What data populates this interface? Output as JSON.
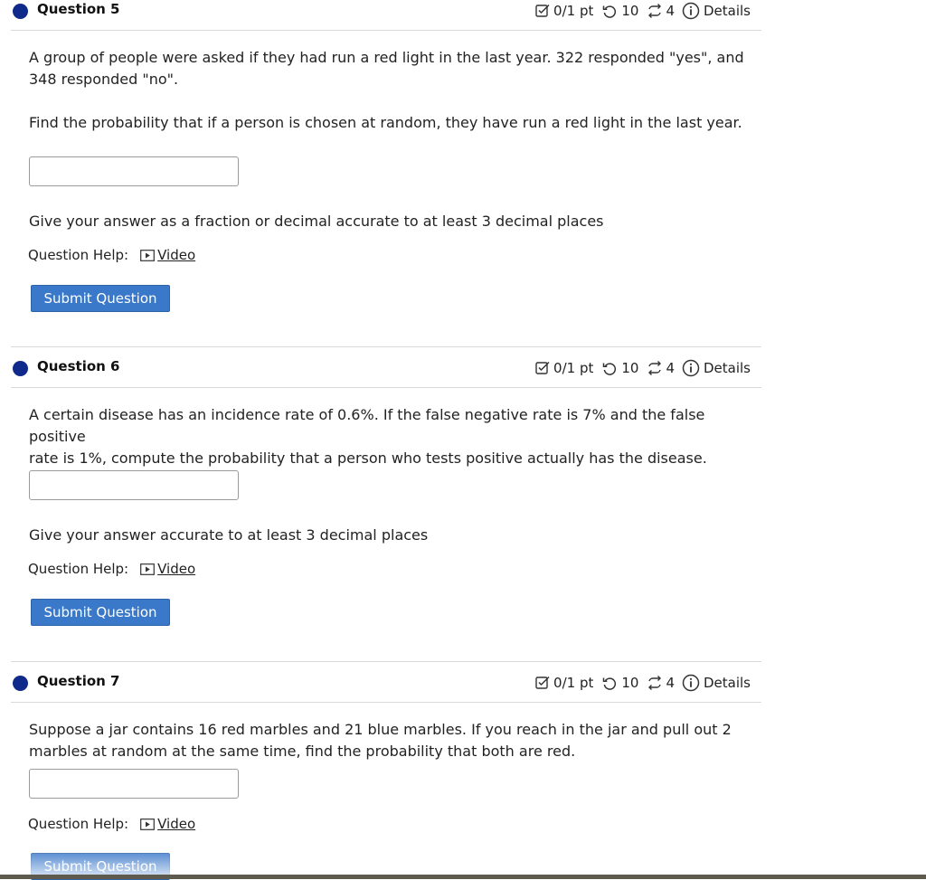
{
  "questions": [
    {
      "title": "Question 5",
      "score": "0/1 pt",
      "retries": "10",
      "attempts": "4",
      "details_label": "Details",
      "text_lines": [
        "A group of people were asked if they had run a red light in the last year. 322 responded \"yes\", and",
        "348 responded \"no\"."
      ],
      "text2": "Find the probability that if a person is chosen at random, they have run a red light in the last year.",
      "answer_value": "",
      "hint": "Give your answer as a fraction or decimal accurate to at least 3 decimal places",
      "help_label": "Question Help:",
      "video_label": "Video",
      "submit_label": "Submit Question"
    },
    {
      "title": "Question 6",
      "score": "0/1 pt",
      "retries": "10",
      "attempts": "4",
      "details_label": "Details",
      "text_lines": [
        "A certain disease has an incidence rate of 0.6%. If the false negative rate is 7% and the false positive",
        "rate is 1%, compute the probability that a person who tests positive actually has the disease."
      ],
      "answer_value": "",
      "hint": "Give your answer accurate to at least 3 decimal places",
      "help_label": "Question Help:",
      "video_label": "Video",
      "submit_label": "Submit Question"
    },
    {
      "title": "Question 7",
      "score": "0/1 pt",
      "retries": "10",
      "attempts": "4",
      "details_label": "Details",
      "text_lines": [
        "Suppose a jar contains 16 red marbles and 21 blue marbles. If you reach in the jar and pull out 2",
        "marbles at random at the same time, find the probability that both are red."
      ],
      "answer_value": "",
      "help_label": "Question Help:",
      "video_label": "Video",
      "submit_label": "Submit Question"
    }
  ],
  "icons": {
    "score": "checkbox-pencil-icon",
    "retries": "retry-icon",
    "attempts": "attempts-cycle-icon",
    "details": "info-icon",
    "video": "video-play-icon",
    "status": "status-dot-icon"
  },
  "colors": {
    "status_dot": "#0f2a8a",
    "submit_button": "#3a78c9"
  }
}
